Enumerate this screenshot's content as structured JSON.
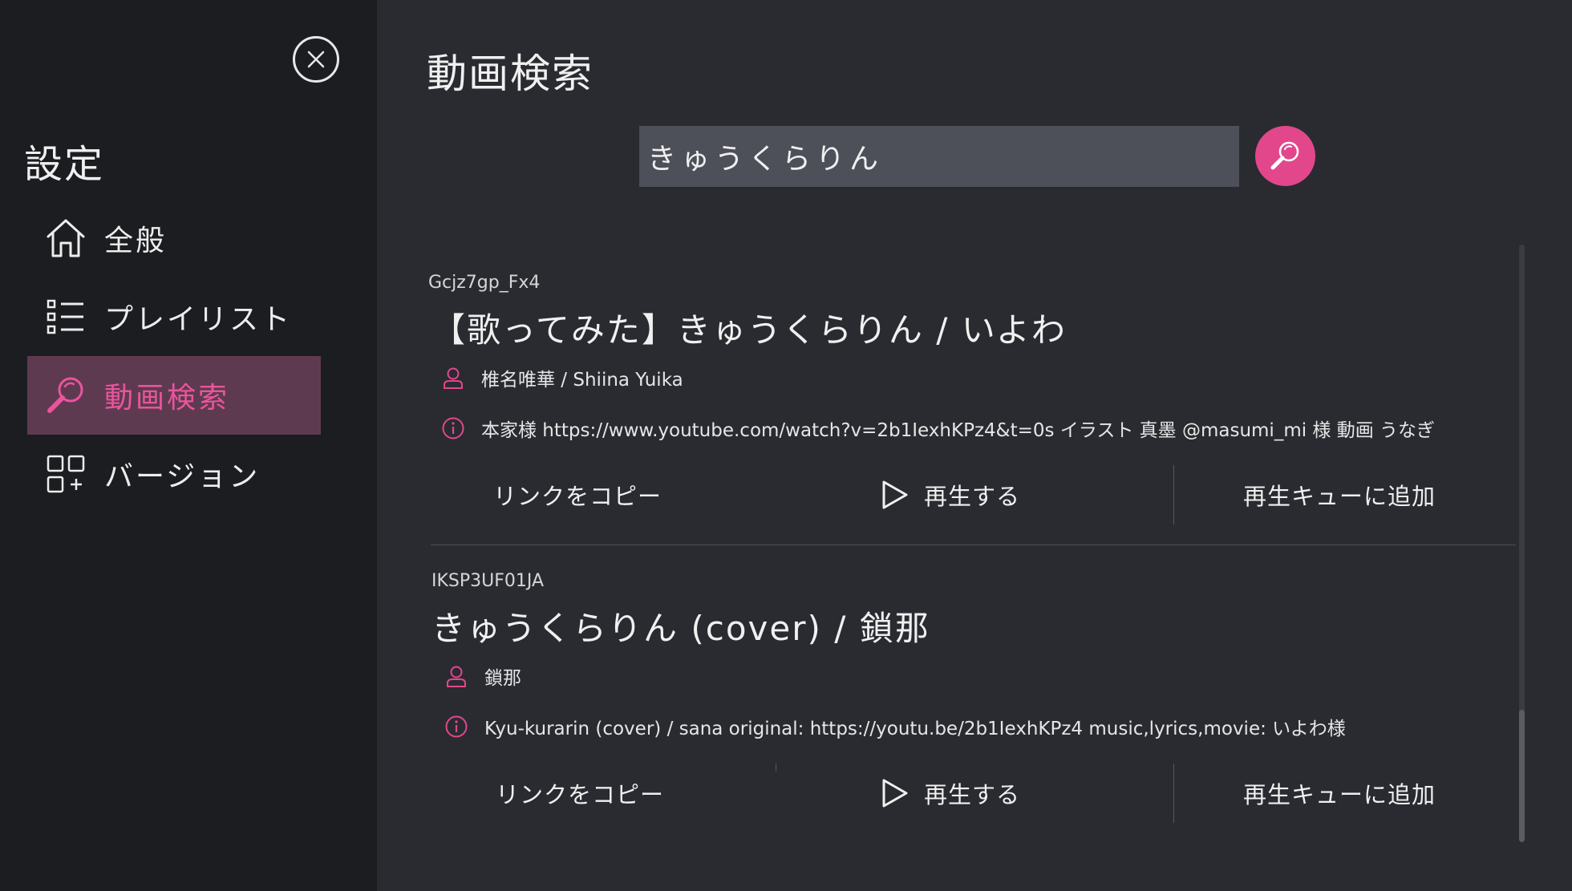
{
  "sidebar": {
    "title": "設定",
    "items": [
      {
        "label": "全般",
        "icon": "home-icon"
      },
      {
        "label": "プレイリスト",
        "icon": "list-icon"
      },
      {
        "label": "動画検索",
        "icon": "search-icon",
        "active": true
      },
      {
        "label": "バージョン",
        "icon": "apps-add-icon"
      }
    ]
  },
  "main": {
    "title": "動画検索",
    "search": {
      "value": "きゅうくらりん"
    },
    "results": [
      {
        "id": "Gcjz7gp_Fx4",
        "title": "【歌ってみた】きゅうくらりん / いよわ",
        "author": "椎名唯華 / Shiina Yuika",
        "description": "本家様 https://www.youtube.com/watch?v=2b1IexhKPz4&t=0s イラスト 真墨 @masumi_mi 様 動画 うなぎ"
      },
      {
        "id": "IKSP3UF01JA",
        "title": "きゅうくらりん (cover) / 鎖那",
        "author": "鎖那",
        "description": "Kyu-kurarin (cover) / sana original: https://youtu.be/2b1IexhKPz4 music,lyrics,movie: いよわ様"
      }
    ],
    "actions": {
      "copy": "リンクをコピー",
      "play": "再生する",
      "queue": "再生キューに追加"
    }
  },
  "colors": {
    "accent": "#e2478c",
    "active_bg": "#5e3a50",
    "sidebar_bg": "#1c1d21",
    "main_bg": "#2a2b31",
    "input_bg": "#4d5059"
  }
}
